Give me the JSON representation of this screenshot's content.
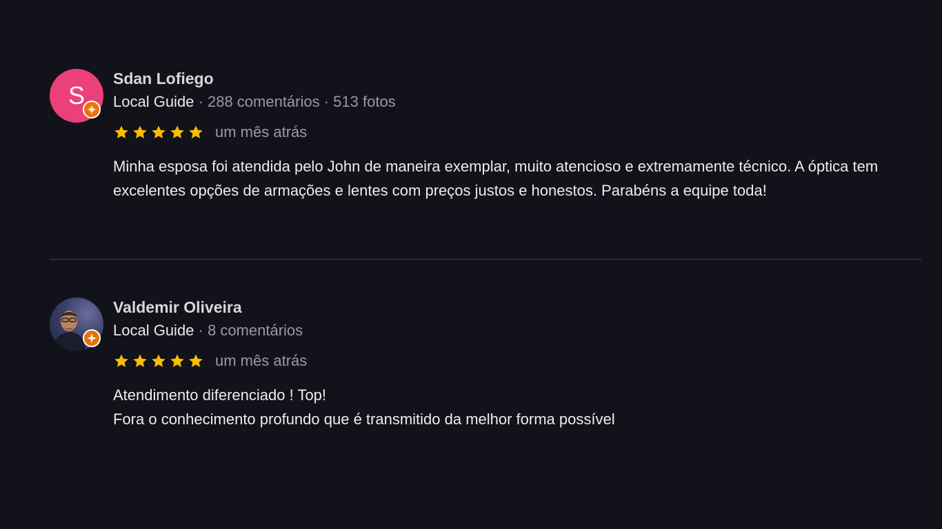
{
  "reviews": [
    {
      "avatar_letter": "S",
      "avatar_color": "#ec407a",
      "name": "Sdan Lofiego",
      "guide_label": "Local Guide",
      "stats": " · 288 comentários · 513 fotos",
      "rating": 5,
      "date": "um mês atrás",
      "text_lines": [
        "Minha esposa foi atendida pelo John de maneira exemplar, muito atencioso e extremamente técnico. A óptica tem excelentes opções de armações e lentes com preços justos e honestos. Parabéns a equipe toda!"
      ]
    },
    {
      "avatar_letter": "",
      "name": "Valdemir Oliveira",
      "guide_label": "Local Guide",
      "stats": " · 8 comentários",
      "rating": 5,
      "date": "um mês atrás",
      "text_lines": [
        "Atendimento diferenciado ! Top!",
        "Fora o conhecimento profundo que é transmitido da melhor forma possível"
      ]
    }
  ],
  "colors": {
    "background": "#12121b",
    "star": "#fbbc04",
    "badge": "#e8710a"
  },
  "icons": {
    "star": "star-icon",
    "badge": "local-guide-badge-icon"
  }
}
